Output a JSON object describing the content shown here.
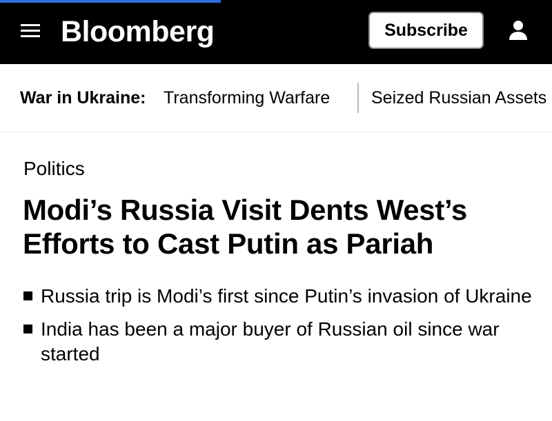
{
  "header": {
    "logo": "Bloomberg",
    "subscribe_label": "Subscribe",
    "menu_icon": "hamburger-menu-icon",
    "user_icon": "user-account-icon",
    "background_color": "#000000",
    "progress_color": "#2f6fe0",
    "progress_fraction": 0.4
  },
  "subnav": {
    "label": "War in Ukraine:",
    "links": [
      {
        "label": "Transforming Warfare"
      },
      {
        "label": "Seized Russian Assets"
      }
    ]
  },
  "article": {
    "section": "Politics",
    "headline": "Modi’s Russia Visit Dents West’s Efforts to Cast Putin as Pariah",
    "bullets": [
      "Russia trip is Modi’s first since Putin’s invasion of Ukraine",
      "India has been a major buyer of Russian oil since war started"
    ]
  }
}
